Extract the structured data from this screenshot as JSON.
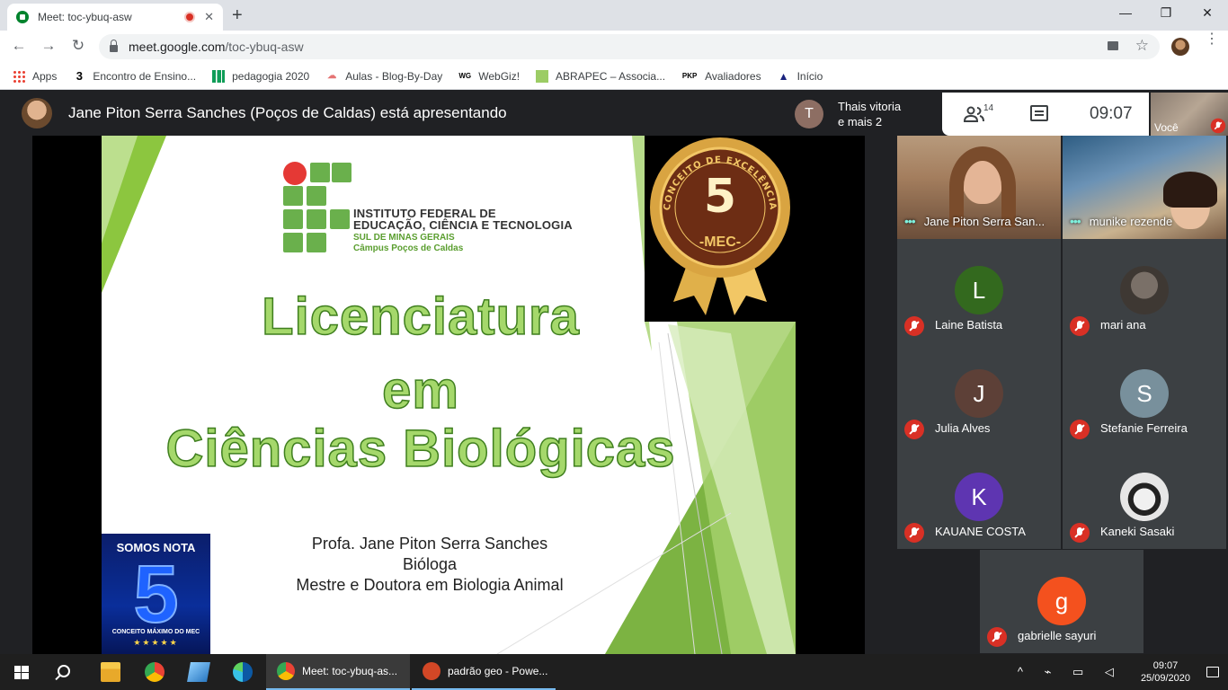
{
  "browser": {
    "tab_title": "Meet: toc-ybuq-asw",
    "tab_close": "✕",
    "new_tab": "+",
    "window_min": "—",
    "window_max": "❐",
    "window_close": "✕",
    "url_host": "meet.google.com",
    "url_path": "/toc-ybuq-asw",
    "back": "←",
    "forward": "→",
    "reload": "↻",
    "star": "☆",
    "menu": "⋮"
  },
  "bookmarks": [
    {
      "label": "Apps",
      "icon": "apps-grid-icon",
      "glyph": ""
    },
    {
      "label": "Encontro de Ensino...",
      "icon": "number-3-icon",
      "glyph": "3"
    },
    {
      "label": "pedagogia 2020",
      "icon": "sheets-icon",
      "glyph": ""
    },
    {
      "label": "Aulas - Blog-By-Day",
      "icon": "blog-icon",
      "glyph": "☁"
    },
    {
      "label": "WebGiz!",
      "icon": "wg-icon",
      "glyph": "WG"
    },
    {
      "label": "ABRAPEC – Associa...",
      "icon": "abrapec-icon",
      "glyph": ""
    },
    {
      "label": "Avaliadores",
      "icon": "pkp-icon",
      "glyph": "PKP"
    },
    {
      "label": "Início",
      "icon": "home-icon",
      "glyph": "▲"
    }
  ],
  "meet": {
    "presenter_text": "Jane Piton Serra Sanches (Poços de Caldas) está apresentando",
    "thais_initial": "T",
    "thais_line1": "Thais vitoria",
    "thais_line2": "e mais 2",
    "people_count": "14",
    "clock": "09:07",
    "self_label": "Você"
  },
  "slide": {
    "if_line1": "INSTITUTO FEDERAL DE",
    "if_line2": "EDUCAÇÃO, CIÊNCIA E TECNOLOGIA",
    "if_line3": "SUL DE MINAS GERAIS",
    "if_line4": "Câmpus Poços de Caldas",
    "title_1": "Licenciatura",
    "title_2": "em",
    "title_3": "Ciências Biológicas",
    "credit_1": "Profa. Jane Piton Serra Sanches",
    "credit_2": "Bióloga",
    "credit_3": "Mestre e Doutora em Biologia Animal",
    "badge_arc": "CONCEITO DE EXCELÊNCIA",
    "badge_number": "5",
    "badge_mec": "-MEC-",
    "nota_top": "SOMOS NOTA",
    "nota_five": "5",
    "nota_bottom": "CONCEITO MÁXIMO DO MEC",
    "nota_stars": "★★★★★"
  },
  "participants_video": [
    {
      "name": "Jane Piton Serra San..."
    },
    {
      "name": "munike rezende"
    }
  ],
  "participants": [
    {
      "name": "Laine Batista",
      "initial": "L",
      "color": "#33691e"
    },
    {
      "name": "mari ana",
      "initial": "",
      "color": "#4a4540"
    },
    {
      "name": "Julia Alves",
      "initial": "J",
      "color": "#5d4037"
    },
    {
      "name": "Stefanie Ferreira",
      "initial": "S",
      "color": "#78909c"
    },
    {
      "name": "KAUANE COSTA",
      "initial": "K",
      "color": "#5e35b1"
    },
    {
      "name": "Kaneki Sasaki",
      "initial": "",
      "color": "#e0e0e0"
    },
    {
      "name": "gabrielle sayuri",
      "initial": "g",
      "color": "#f4511e"
    }
  ],
  "taskbar": {
    "chrome_app": "Meet: toc-ybuq-as...",
    "ppt_app": "padrão geo - Powe...",
    "tray_icons": "^ ⌁ ▭ ◁",
    "time": "09:07",
    "date": "25/09/2020"
  }
}
